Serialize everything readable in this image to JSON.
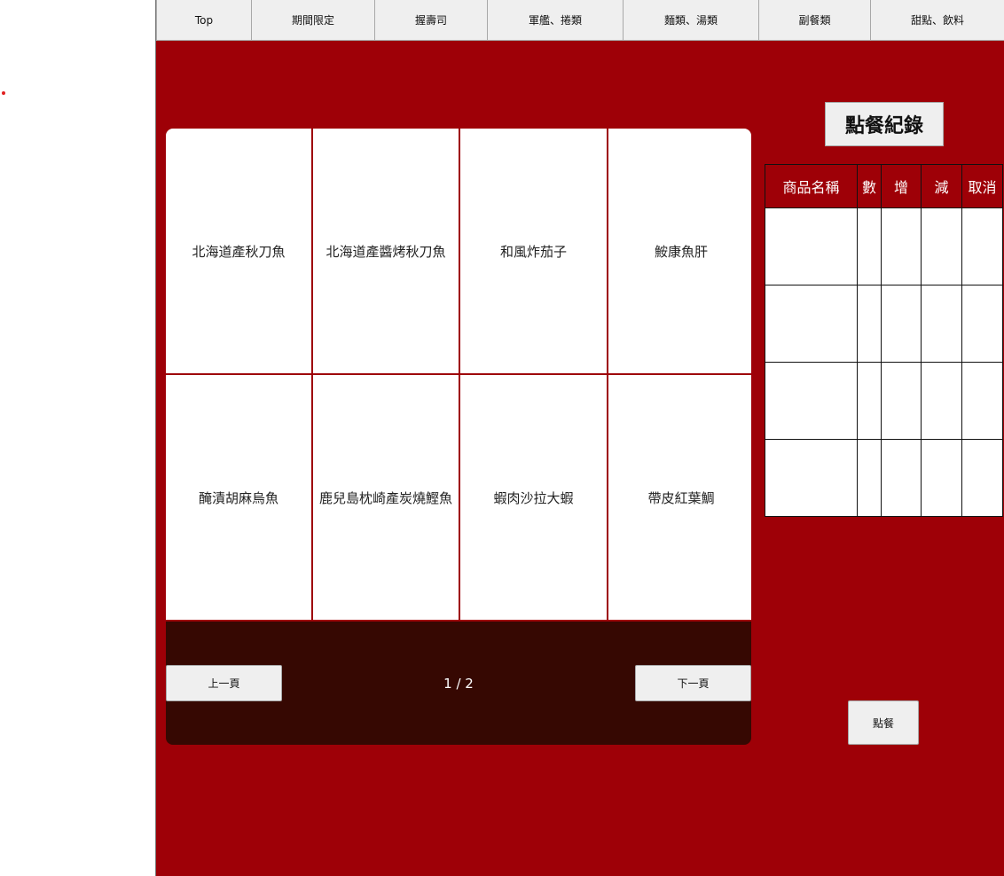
{
  "nav": {
    "tabs": [
      {
        "label": "Top"
      },
      {
        "label": "期間限定"
      },
      {
        "label": "握壽司"
      },
      {
        "label": "軍艦、捲類"
      },
      {
        "label": "麵類、湯類"
      },
      {
        "label": "副餐類"
      },
      {
        "label": "甜點、飲料"
      }
    ]
  },
  "menu": {
    "items": [
      {
        "name": "北海道產秋刀魚"
      },
      {
        "name": "北海道產醬烤秋刀魚"
      },
      {
        "name": "和風炸茄子"
      },
      {
        "name": "鮟康魚肝"
      },
      {
        "name": "醃漬胡麻烏魚"
      },
      {
        "name": "鹿兒島枕崎產炭燒鰹魚"
      },
      {
        "name": "蝦肉沙拉大蝦"
      },
      {
        "name": "帶皮紅葉鯛"
      }
    ]
  },
  "pager": {
    "prev_label": "上一頁",
    "next_label": "下一頁",
    "page_indicator": "1 / 2"
  },
  "history": {
    "title": "點餐紀錄",
    "columns": [
      "商品名稱",
      "數",
      "增",
      "減",
      "取消"
    ],
    "rows": [
      [
        "",
        "",
        "",
        "",
        ""
      ],
      [
        "",
        "",
        "",
        "",
        ""
      ],
      [
        "",
        "",
        "",
        "",
        ""
      ],
      [
        "",
        "",
        "",
        "",
        ""
      ]
    ]
  },
  "order_button": {
    "label": "點餐"
  },
  "colors": {
    "background": "#9e0007",
    "panel": "#360802",
    "button": "#efefef"
  }
}
